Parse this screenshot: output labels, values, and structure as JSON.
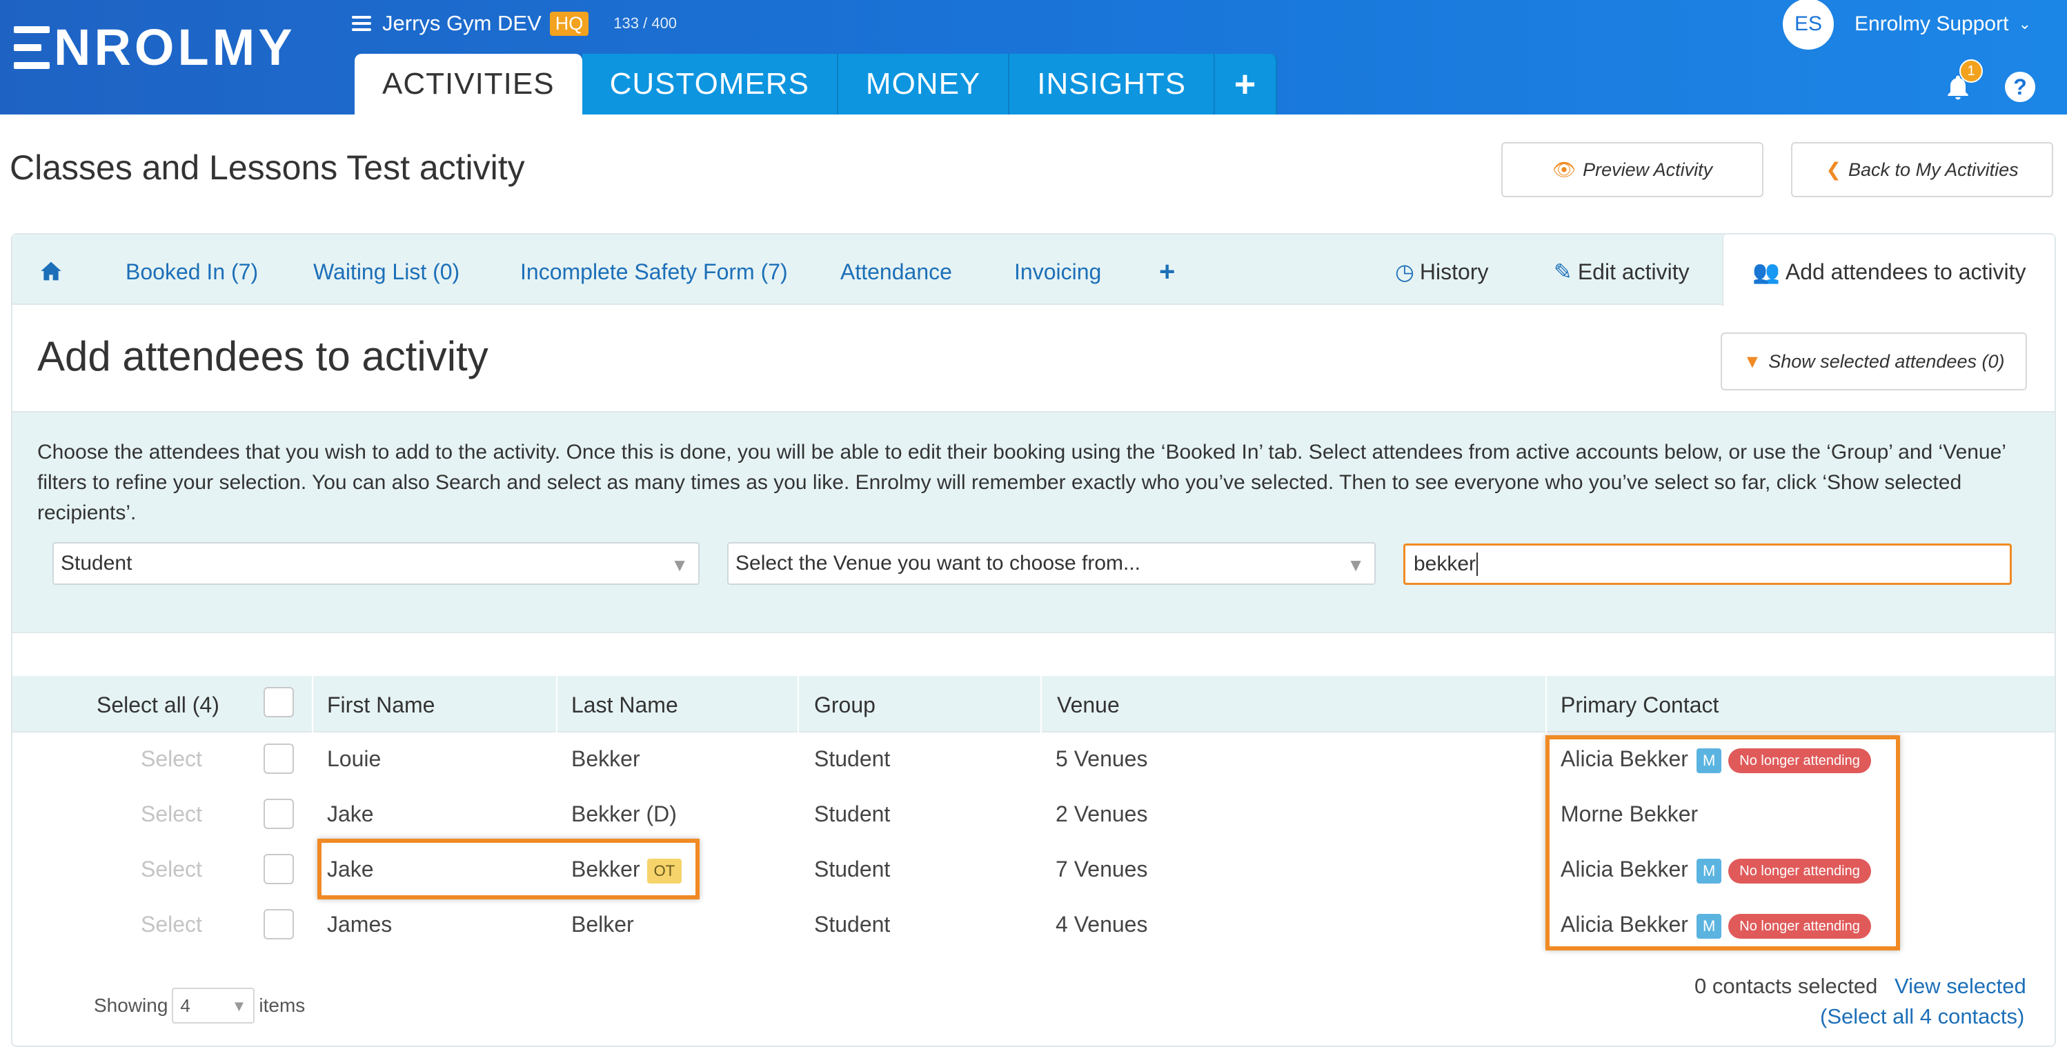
{
  "brand": {
    "logo_text": "NROLMY"
  },
  "account": {
    "name": "Jerrys Gym DEV",
    "badge": "HQ",
    "count": "133 / 400"
  },
  "nav": {
    "tabs": [
      "ACTIVITIES",
      "CUSTOMERS",
      "MONEY",
      "INSIGHTS"
    ],
    "plus": "+"
  },
  "user": {
    "initials": "ES",
    "name": "Enrolmy Support",
    "notifications": "1",
    "help": "?"
  },
  "page": {
    "title": "Classes and Lessons Test activity",
    "preview_label": "Preview Activity",
    "back_label": "Back to My Activities"
  },
  "subtabs": {
    "booked": "Booked In (7)",
    "waiting": "Waiting List (0)",
    "safety": "Incomplete Safety Form (7)",
    "attendance": "Attendance",
    "invoicing": "Invoicing",
    "plus": "+",
    "history": "History",
    "edit": "Edit activity",
    "add": "Add attendees to activity"
  },
  "section": {
    "title": "Add attendees to activity",
    "show_selected": "Show selected attendees (0)",
    "intro": "Choose the attendees that you wish to add to the activity. Once this is done, you will be able to edit their booking using the ‘Booked In’ tab. Select attendees from active accounts below, or use the ‘Group’ and ‘Venue’ filters to refine your selection. You can also Search and select as many times as you like. Enrolmy will remember exactly who you’ve selected. Then to see everyone who you’ve select so far, click ‘Show selected recipients’."
  },
  "filters": {
    "group_value": "Student",
    "venue_placeholder": "Select the Venue you want to choose from...",
    "search_value": "bekker"
  },
  "table": {
    "select_all": "Select all (4)",
    "headers": {
      "first": "First Name",
      "last": "Last Name",
      "group": "Group",
      "venue": "Venue",
      "contact": "Primary Contact"
    },
    "rows": [
      {
        "select": "Select",
        "first": "Louie",
        "last": "Bekker",
        "tag": "",
        "group": "Student",
        "venue": "5 Venues",
        "contact": "Alicia Bekker",
        "m": "M",
        "status": "No longer attending"
      },
      {
        "select": "Select",
        "first": "Jake",
        "last": "Bekker (D)",
        "tag": "",
        "group": "Student",
        "venue": "2 Venues",
        "contact": "Morne Bekker",
        "m": "",
        "status": ""
      },
      {
        "select": "Select",
        "first": "Jake",
        "last": "Bekker",
        "tag": "OT",
        "group": "Student",
        "venue": "7 Venues",
        "contact": "Alicia Bekker",
        "m": "M",
        "status": "No longer attending"
      },
      {
        "select": "Select",
        "first": "James",
        "last": "Belker",
        "tag": "",
        "group": "Student",
        "venue": "4 Venues",
        "contact": "Alicia Bekker",
        "m": "M",
        "status": "No longer attending"
      }
    ]
  },
  "footer": {
    "showing": "Showing",
    "page_size": "4",
    "items": "items",
    "contacts_selected": "0 contacts selected",
    "view_selected": "View selected",
    "select_all_contacts": "(Select all 4 contacts)"
  },
  "colors": {
    "header_blue": "#1a74d8",
    "nav_tab": "#0d95e0",
    "accent_orange": "#f08a24",
    "link_blue": "#1c6fb8",
    "status_red": "#e05a5a"
  }
}
